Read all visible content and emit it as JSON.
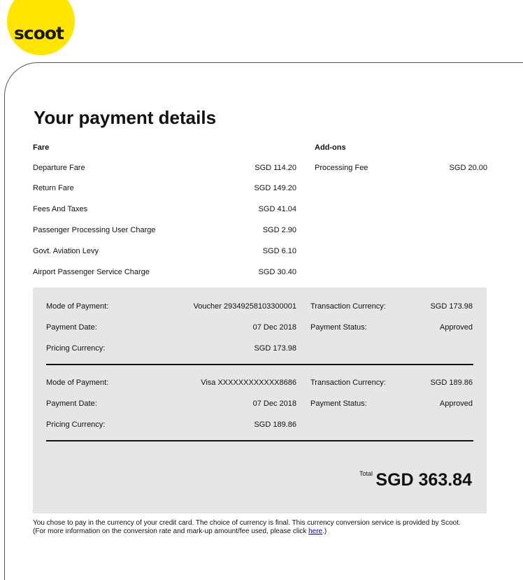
{
  "logo": {
    "text": "scoot",
    "color": "#FFE600"
  },
  "title": "Your payment details",
  "fare": {
    "heading": "Fare",
    "items": [
      {
        "label": "Departure Fare",
        "value": "SGD 114.20"
      },
      {
        "label": "Return Fare",
        "value": "SGD 149.20"
      },
      {
        "label": "Fees And Taxes",
        "value": "SGD 41.04"
      },
      {
        "label": "Passenger Processing User Charge",
        "value": "SGD 2.90"
      },
      {
        "label": "Govt. Aviation Levy",
        "value": "SGD 6.10"
      },
      {
        "label": "Airport Passenger Service Charge",
        "value": "SGD 30.40"
      }
    ]
  },
  "addons": {
    "heading": "Add-ons",
    "items": [
      {
        "label": "Processing Fee",
        "value": "SGD 20.00"
      }
    ]
  },
  "payments": [
    {
      "mode_label": "Mode of Payment:",
      "mode_value": "Voucher 29349258103300001",
      "date_label": "Payment Date:",
      "date_value": "07 Dec 2018",
      "pricing_label": "Pricing Currency:",
      "pricing_value": "SGD 173.98",
      "txn_label": "Transaction Currency:",
      "txn_value": "SGD 173.98",
      "status_label": "Payment Status:",
      "status_value": "Approved"
    },
    {
      "mode_label": "Mode of Payment:",
      "mode_value": "Visa XXXXXXXXXXXX8686",
      "date_label": "Payment Date:",
      "date_value": "07 Dec 2018",
      "pricing_label": "Pricing Currency:",
      "pricing_value": "SGD 189.86",
      "txn_label": "Transaction Currency:",
      "txn_value": "SGD 189.86",
      "status_label": "Payment Status:",
      "status_value": "Approved"
    }
  ],
  "total": {
    "label": "Total",
    "value": "SGD 363.84"
  },
  "note": {
    "line1": "You chose to pay in the currency of your credit card. The choice of currency is final. This currency conversion service is provided by Scoot.",
    "line2_pre": "(For more information on the conversion rate and mark-up amount/fee used, please click ",
    "link": "here",
    "line2_post": ".)"
  }
}
